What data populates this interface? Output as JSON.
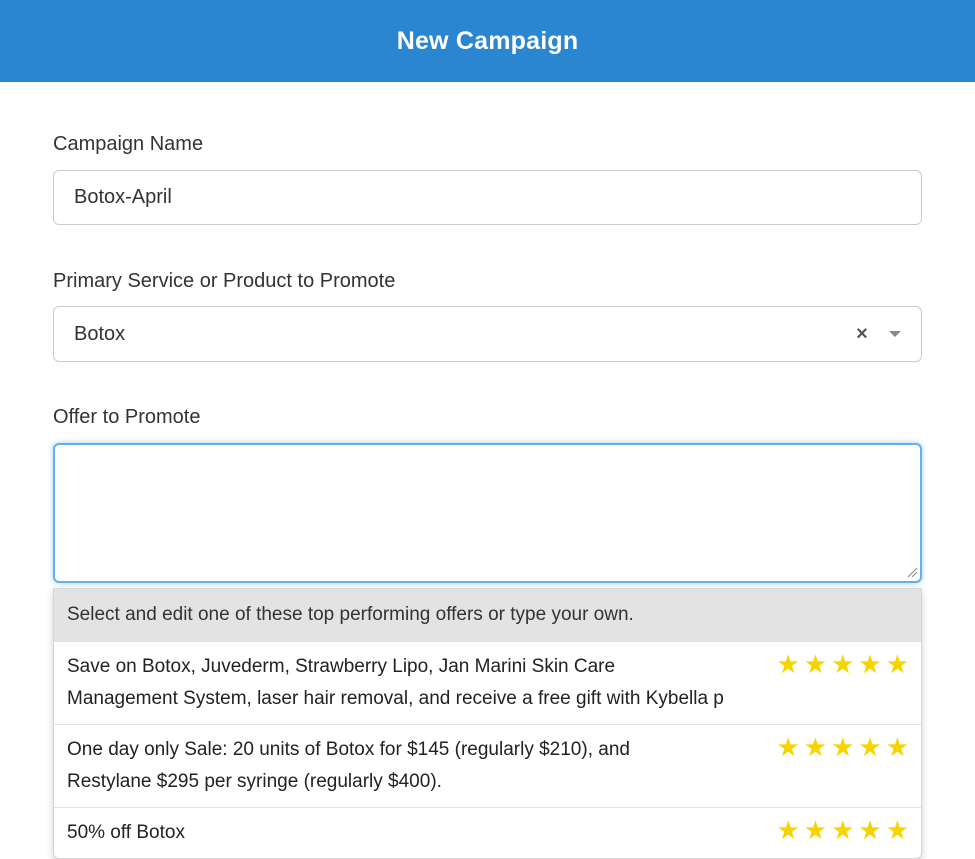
{
  "header": {
    "title": "New Campaign"
  },
  "colors": {
    "header_bg": "#2a86d1",
    "star": "#f5d500",
    "focus_border": "#66afe9"
  },
  "form": {
    "campaign_name": {
      "label": "Campaign Name",
      "value": "Botox-April"
    },
    "primary_service": {
      "label": "Primary Service or Product to Promote",
      "value": "Botox",
      "clear_icon": "close-icon",
      "toggle_icon": "chevron-down-icon"
    },
    "offer": {
      "label": "Offer to Promote",
      "value": ""
    }
  },
  "suggestions": {
    "header": "Select and edit one of these top performing offers or type your own.",
    "items": [
      {
        "line1": "Save on Botox, Juvederm, Strawberry Lipo, Jan Marini Skin Care",
        "line2": "Management System, laser hair removal, and receive a free gift with Kybella p",
        "rating": 5
      },
      {
        "line1": "One day only Sale: 20 units of Botox for $145 (regularly $210), and",
        "line2": "Restylane $295 per syringe (regularly $400).",
        "rating": 5
      },
      {
        "line1": "50% off Botox",
        "line2": "",
        "rating": 5
      }
    ]
  }
}
